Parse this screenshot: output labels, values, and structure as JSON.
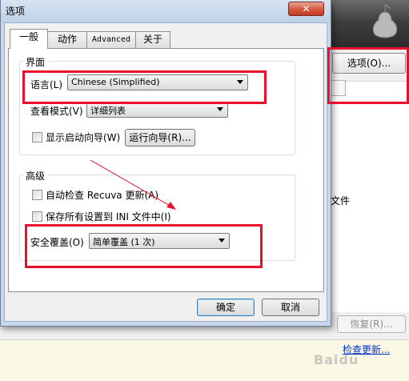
{
  "background": {
    "options_button_label": "选项(O)...",
    "file_text": "文件",
    "restore_button_label": "恢复(R)...",
    "check_update_link": "检查更新...",
    "watermark_text": "Baidu"
  },
  "dialog": {
    "title": "选项",
    "close_glyph": "✕",
    "tabs": [
      {
        "label": "一般",
        "active": true
      },
      {
        "label": "动作",
        "active": false
      },
      {
        "label": "Advanced",
        "active": false
      },
      {
        "label": "关于",
        "active": false
      }
    ],
    "interface_group": {
      "title": "界面",
      "language_label": "语言(L)",
      "language_value": "Chinese (Simplified)",
      "view_mode_label": "查看模式(V)",
      "view_mode_value": "详细列表",
      "show_wizard_label": "显示启动向导(W)",
      "show_wizard_checked": false,
      "run_wizard_button": "运行向导(R)..."
    },
    "advanced_group": {
      "title": "高级",
      "auto_update_label": "自动检查 Recuva 更新(A)",
      "auto_update_checked": false,
      "save_ini_label": "保存所有设置到 INI 文件中(I)",
      "save_ini_checked": false,
      "secure_overwrite_label": "安全覆盖(O)",
      "secure_overwrite_value": "简单覆盖 (1 次)"
    },
    "ok_button": "确定",
    "cancel_button": "取消"
  },
  "annotation_color": "#e8102a"
}
